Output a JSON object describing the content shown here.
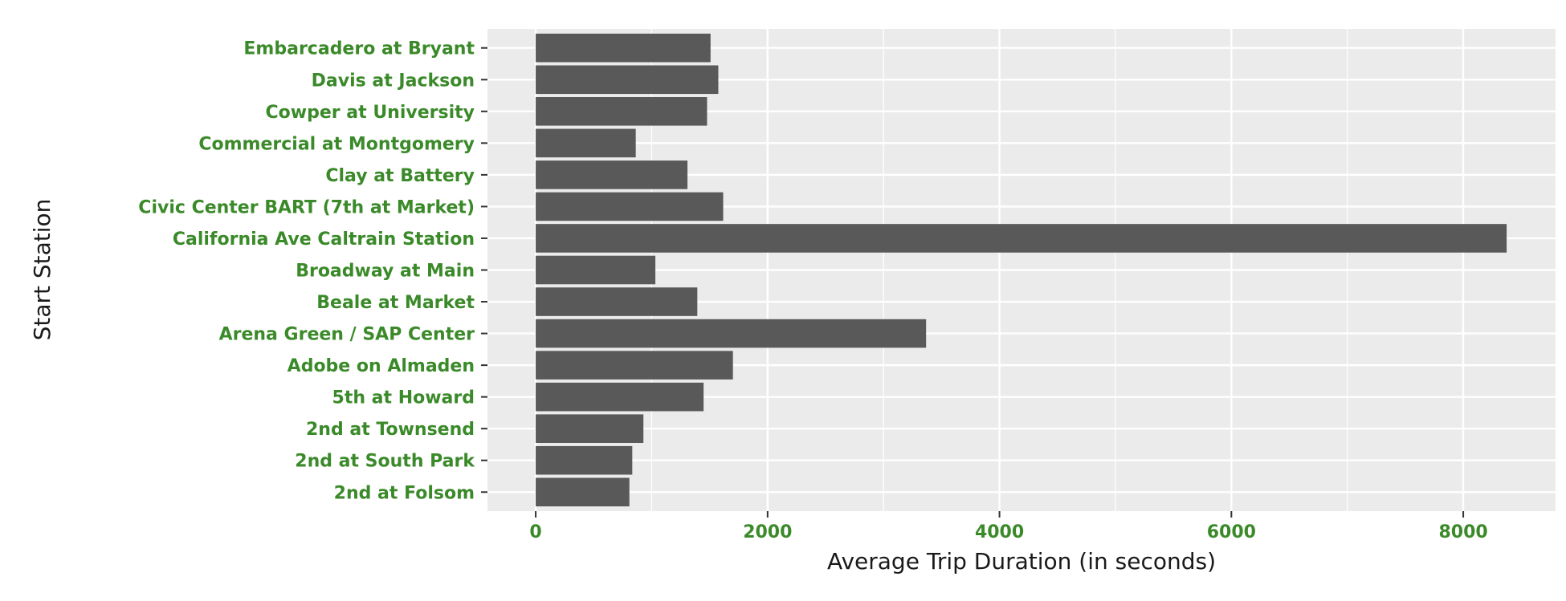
{
  "chart_data": {
    "type": "bar",
    "orientation": "horizontal",
    "title": "",
    "xlabel": "Average Trip Duration (in seconds)",
    "ylabel": "Start Station",
    "xlim": [
      -416,
      8796
    ],
    "xticks": [
      0,
      2000,
      4000,
      6000,
      8000
    ],
    "xtick_labels": [
      "0",
      "2000",
      "4000",
      "6000",
      "8000"
    ],
    "grid": true,
    "categories": [
      "Embarcadero at Bryant",
      "Davis at Jackson",
      "Cowper at University",
      "Commercial at Montgomery",
      "Clay at Battery",
      "Civic Center BART (7th at Market)",
      "California Ave Caltrain Station",
      "Broadway at Main",
      "Beale at Market",
      "Arena Green / SAP Center",
      "Adobe on Almaden",
      "5th at Howard",
      "2nd at Townsend",
      "2nd at South Park",
      "2nd at Folsom"
    ],
    "values": [
      1508,
      1575,
      1478,
      863,
      1309,
      1617,
      8374,
      1032,
      1394,
      3367,
      1701,
      1448,
      929,
      833,
      808
    ],
    "colors": {
      "bar": "#595959",
      "panel": "#EBEBEB",
      "grid": "#FFFFFF",
      "tick_label": "#3b8a2a"
    }
  }
}
